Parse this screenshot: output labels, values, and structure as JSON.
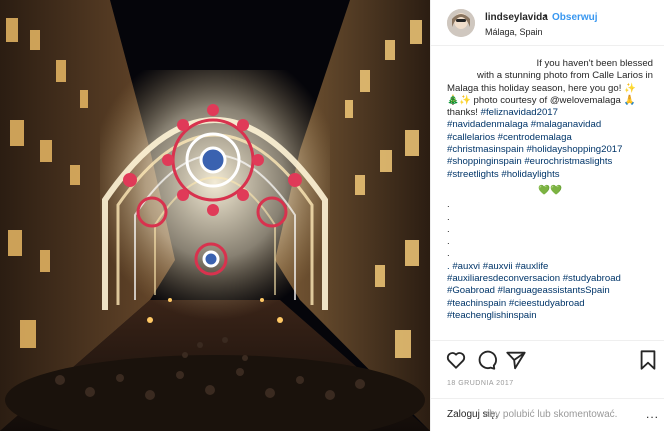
{
  "post": {
    "username": "lindseylavida",
    "separator": "•",
    "follow_label": "Obserwuj",
    "location": "Málaga, Spain"
  },
  "caption": {
    "intro": [
      "If you haven't been blessed",
      "with a stunning photo from Calle Larios in",
      "Malaga this holiday season, here you go! ✨",
      "🎄✨ photo courtesy of @welovemalaga 🙏",
      "thanks!"
    ],
    "hashtags_1": [
      "#feliznavidad2017",
      "#navidadenmalaga #malaganavidad",
      "#callelarios #centrodemalaga",
      "#christmasinspain #holidayshopping2017",
      "#shoppinginspain #eurochristmaslights",
      "#streetlights #holidaylights"
    ],
    "spacer_glyph": "💚💚",
    "dots": [
      ".",
      ".",
      ".",
      ".",
      ".",
      "."
    ],
    "hashtags_2": [
      ". #auxvi #auxvii #auxlife",
      "#auxiliaresdeconversacion #studyabroad",
      "#Goabroad #languageassistantsSpain",
      "#teachinspain #cieestudyabroad",
      "#teachenglishinspain"
    ]
  },
  "actions": {
    "like_icon": "heart-icon",
    "comment_icon": "comment-icon",
    "share_icon": "share-icon",
    "save_icon": "bookmark-icon"
  },
  "date": "18 GRUDNIA 2017",
  "comment_bar": {
    "login_label": "Zaloguj się,",
    "rest_text": "aby polubić lub skomentować.",
    "more_label": "..."
  },
  "colors": {
    "link_blue": "#3897f0",
    "hashtag_blue": "#003569",
    "muted": "#999999",
    "text": "#262626"
  }
}
